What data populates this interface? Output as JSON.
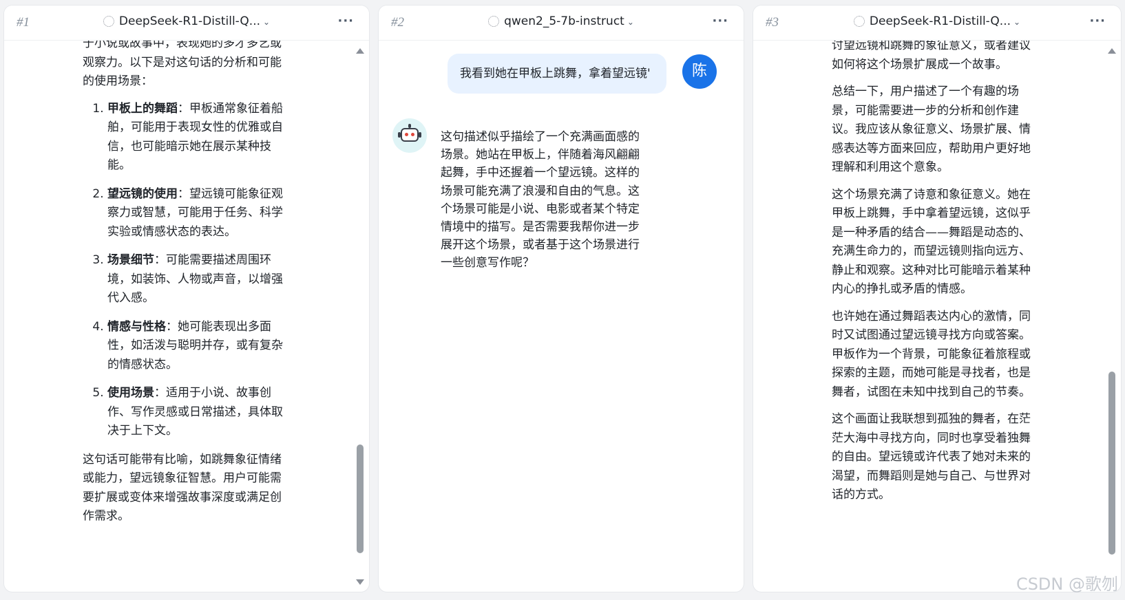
{
  "panels": [
    {
      "number": "#1",
      "model": "DeepSeek-R1-Distill-Q...",
      "content": {
        "top_fragment": "于小说或故事中，表现她的多才多艺或观察力。以下是对这句话的分析和可能的使用场景：",
        "list": [
          {
            "num": "1.",
            "title": "甲板上的舞蹈",
            "text": "：甲板通常象征着船舶，可能用于表现女性的优雅或自信，也可能暗示她在展示某种技能。"
          },
          {
            "num": "2.",
            "title": "望远镜的使用",
            "text": "：望远镜可能象征观察力或智慧，可能用于任务、科学实验或情感状态的表达。"
          },
          {
            "num": "3.",
            "title": "场景细节",
            "text": "：可能需要描述周围环境，如装饰、人物或声音，以增强代入感。"
          },
          {
            "num": "4.",
            "title": "情感与性格",
            "text": "：她可能表现出多面性，如活泼与聪明并存，或有复杂的情感状态。"
          },
          {
            "num": "5.",
            "title": "使用场景",
            "text": "：适用于小说、故事创作、写作灵感或日常描述，具体取决于上下文。"
          }
        ],
        "closing": "这句话可能带有比喻，如跳舞象征情绪或能力，望远镜象征智慧。用户可能需要扩展或变体来增强故事深度或满足创作需求。"
      }
    },
    {
      "number": "#2",
      "model": "qwen2_5-7b-instruct",
      "user_message": "我看到她在甲板上跳舞，拿着望远镜'",
      "user_avatar": "陈",
      "bot_reply": "这句描述似乎描绘了一个充满画面感的场景。她站在甲板上，伴随着海风翩翩起舞，手中还握着一个望远镜。这样的场景可能充满了浪漫和自由的气息。这个场景可能是小说、电影或者某个特定情境中的描写。是否需要我帮你进一步展开这个场景，或者基于这个场景进行一些创意写作呢？"
    },
    {
      "number": "#3",
      "model": "DeepSeek-R1-Distill-Q...",
      "paragraphs": [
        "讨望远镜和跳舞的象征意义，或者建议如何将这个场景扩展成一个故事。",
        "总结一下，用户描述了一个有趣的场景，可能需要进一步的分析和创作建议。我应该从象征意义、场景扩展、情感表达等方面来回应，帮助用户更好地理解和利用这个意象。",
        "这个场景充满了诗意和象征意义。她在甲板上跳舞，手中拿着望远镜，这似乎是一种矛盾的结合——舞蹈是动态的、充满生命力的，而望远镜则指向远方、静止和观察。这种对比可能暗示着某种内心的挣扎或矛盾的情感。",
        "也许她在通过舞蹈表达内心的激情，同时又试图通过望远镜寻找方向或答案。甲板作为一个背景，可能象征着旅程或探索的主题，而她可能是寻找者，也是舞者，试图在未知中找到自己的节奏。",
        "这个画面让我联想到孤独的舞者，在茫茫大海中寻找方向，同时也享受着独舞的自由。望远镜或许代表了她对未来的渴望，而舞蹈则是她与自己、与世界对话的方式。"
      ]
    }
  ],
  "more_glyph": "···",
  "chevron_glyph": "⌄",
  "watermark": "CSDN @歌刎",
  "colors": {
    "user_avatar": "#1a73e8",
    "user_bubble": "#e8f2ff",
    "bot_avatar_bg": "#dff4f6",
    "page_bg": "#f2f3f5"
  },
  "icons": {
    "model_icon": "model-logo-icon",
    "more_icon": "more-options-icon",
    "chevron": "chevron-down-icon"
  }
}
